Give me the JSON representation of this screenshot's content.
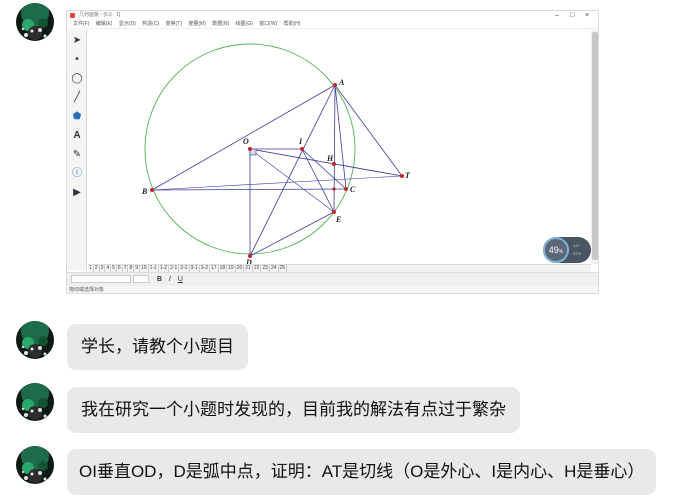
{
  "messages": [
    {
      "type": "image"
    },
    {
      "type": "text",
      "text": "学长，请教个小题目"
    },
    {
      "type": "text",
      "text": "我在研究一个小题时发现的，目前我的解法有点过于繁杂"
    },
    {
      "type": "text",
      "text": "OI垂直OD，D是弧中点，证明：AT是切线（O是外心、I是内心、H是垂心）"
    }
  ],
  "screenshot": {
    "window_title": "几何画板 - [6.0 : 1]",
    "menu": [
      "文件(F)",
      "编辑(E)",
      "显示(D)",
      "构造(C)",
      "变换(T)",
      "度量(M)",
      "数据(N)",
      "绘图(G)",
      "窗口(W)",
      "帮助(H)"
    ],
    "page_tabs": [
      "1",
      "2",
      "3",
      "4",
      "5",
      "6",
      "7",
      "8",
      "9",
      "10",
      "1-1",
      "1-2",
      "2-1",
      "2-2",
      "3-1",
      "3-2",
      "17",
      "18",
      "19",
      "20",
      "21",
      "22",
      "23",
      "24",
      "25"
    ],
    "status_text": "拖动或选择对象",
    "format_buttons": [
      "B",
      "I",
      "U"
    ],
    "speed": {
      "value": "49",
      "unit": "%",
      "up": "1.0",
      "down": "37.9"
    },
    "points": {
      "A": "A",
      "B": "B",
      "C": "C",
      "D": "D",
      "E": "E",
      "H": "H",
      "I": "I",
      "O": "O",
      "T": "T"
    },
    "colors": {
      "circle": "#56b256",
      "lines": "#3b3b9e",
      "points": "#c0262b"
    }
  }
}
